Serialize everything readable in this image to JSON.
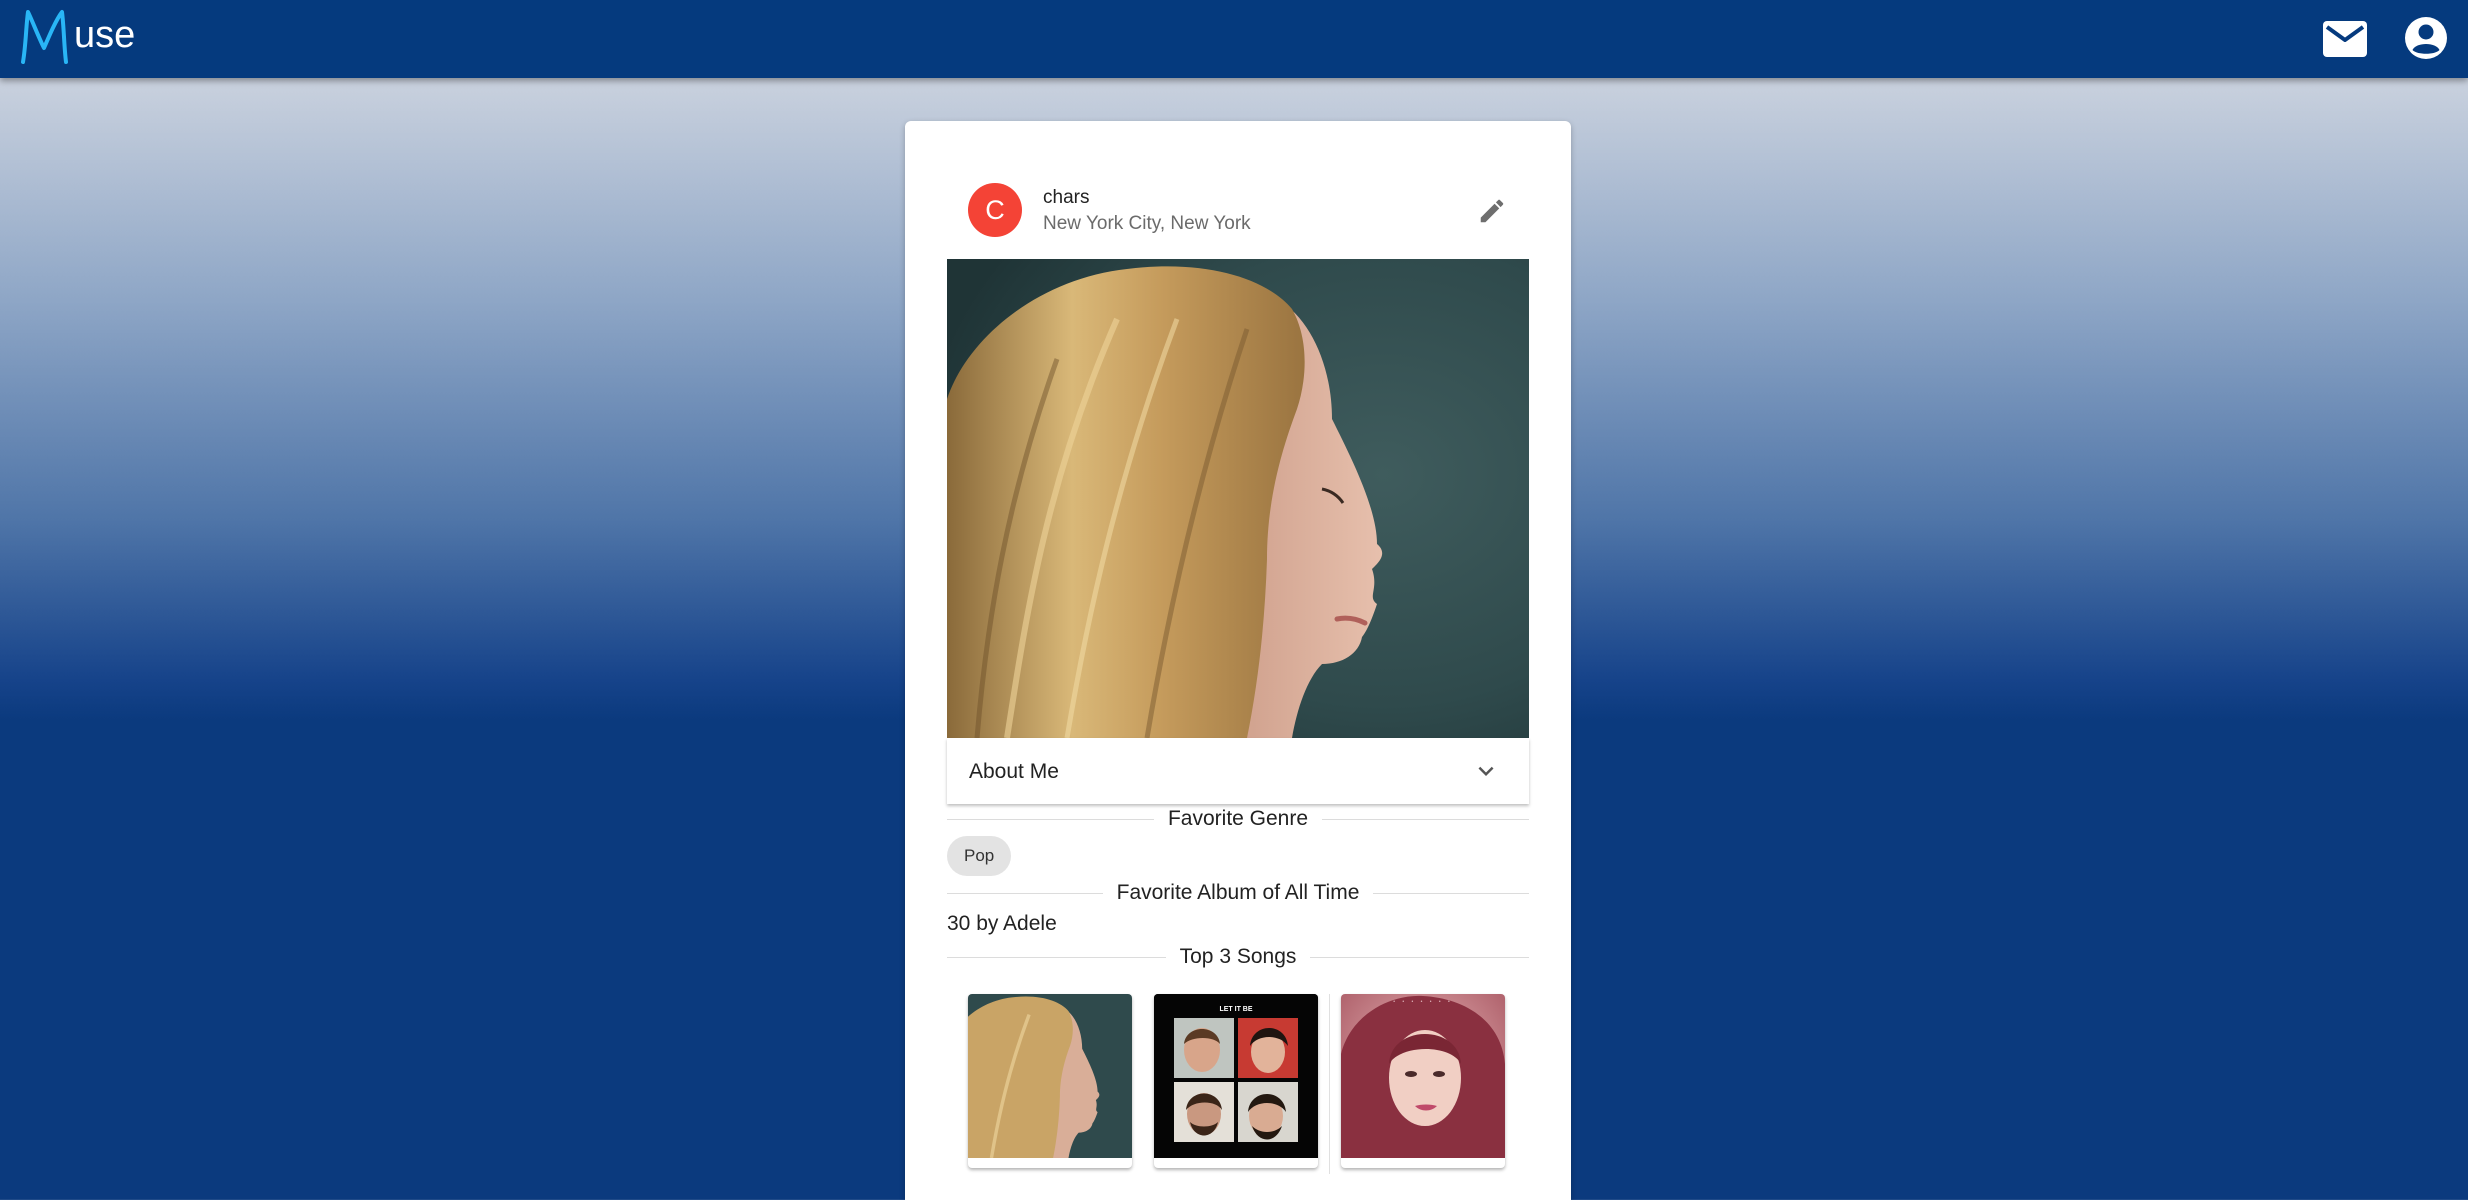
{
  "app": {
    "logo_letter": "M",
    "logo_rest": "use",
    "brand_color": "#053a7e",
    "accent_color": "#29b6f6"
  },
  "toolbar": {
    "mail_icon": "mail-icon",
    "account_icon": "account-circle-icon"
  },
  "profile": {
    "avatar_initial": "C",
    "avatar_color": "#f44336",
    "username": "chars",
    "location": "New York City, New York",
    "edit_icon": "pencil-icon"
  },
  "about": {
    "label": "About Me",
    "icon": "chevron-down-icon"
  },
  "favorite_genre": {
    "heading": "Favorite Genre",
    "chips": [
      "Pop"
    ]
  },
  "favorite_album": {
    "heading": "Favorite Album of All Time",
    "value": "30 by Adele"
  },
  "top_songs": {
    "heading": "Top 3 Songs",
    "items": [
      {
        "art": "adele-30-cover"
      },
      {
        "art": "let-it-be-cover",
        "cover_title": "LET IT BE"
      },
      {
        "art": "portrait-pink-cover"
      }
    ]
  }
}
